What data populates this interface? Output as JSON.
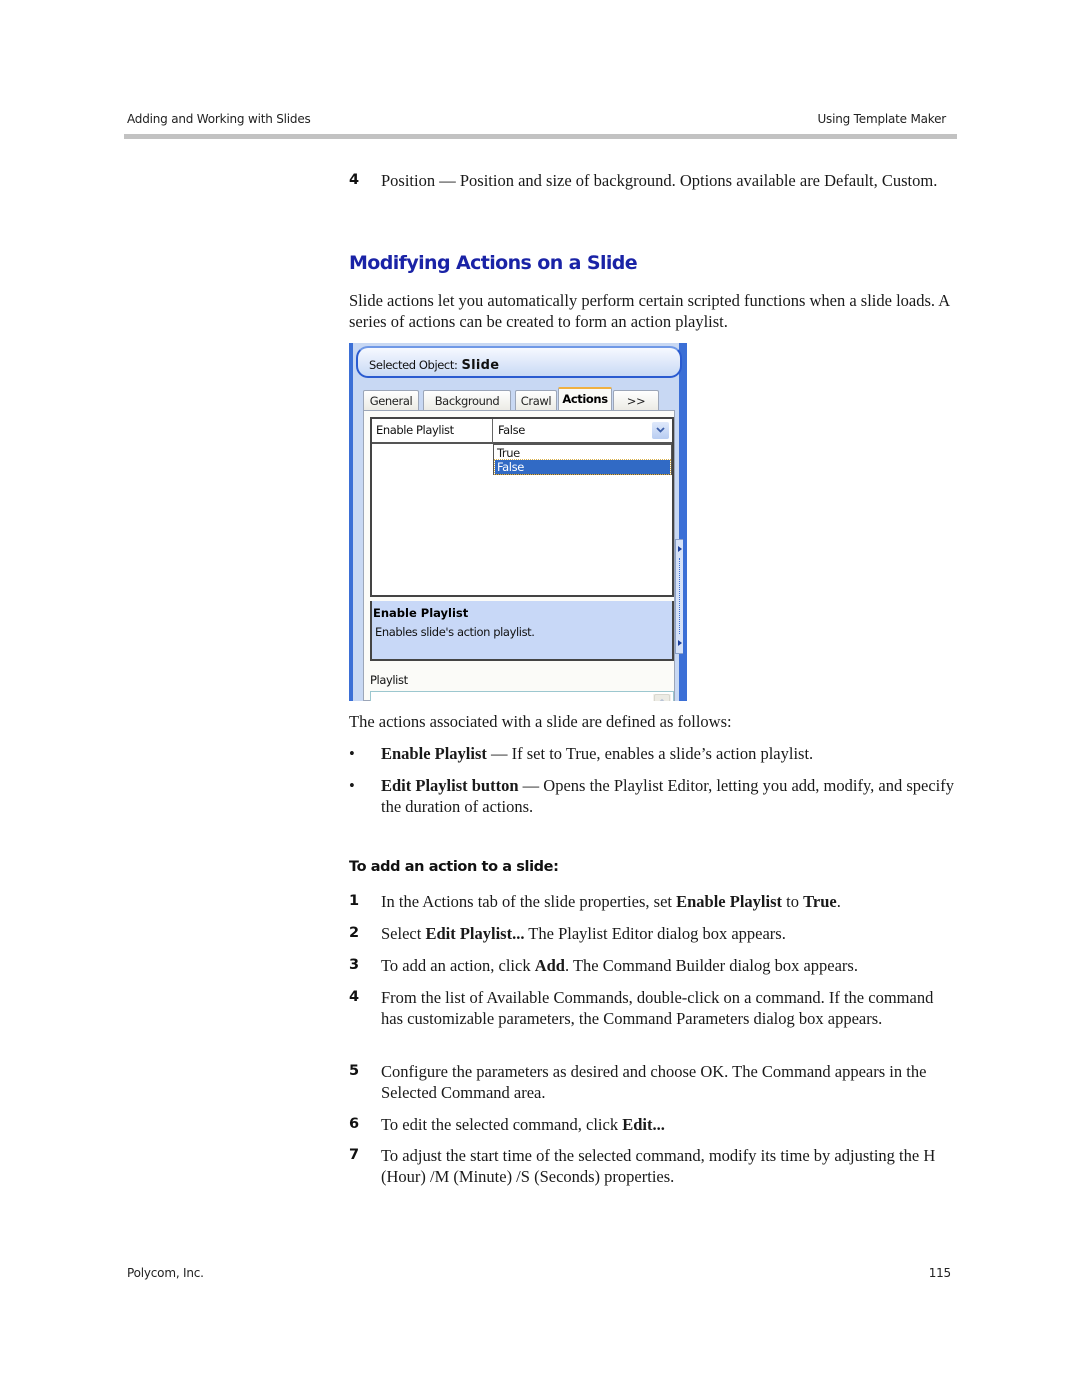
{
  "header": {
    "left": "Adding and Working with Slides",
    "right": "Using Template Maker"
  },
  "intro_step": {
    "number": "4",
    "text": "Position — Position and size of background. Options available are Default, Custom."
  },
  "section": {
    "title": "Modifying Actions on a Slide",
    "intro": "Slide actions let you automatically perform certain scripted functions when a slide loads. A series of actions can be created to form an action playlist."
  },
  "screenshot": {
    "selected_object_label": "Selected Object:",
    "selected_object_value": "Slide",
    "tabs": [
      {
        "label": "General",
        "active": false
      },
      {
        "label": "Background",
        "active": false
      },
      {
        "label": "Crawl",
        "active": false
      },
      {
        "label": "Actions",
        "active": true
      },
      {
        "label": ">>",
        "active": false
      }
    ],
    "property": {
      "name": "Enable Playlist",
      "value": "False",
      "options": [
        {
          "label": "True",
          "selected": false
        },
        {
          "label": "False",
          "selected": true
        }
      ]
    },
    "description": {
      "title": "Enable Playlist",
      "text": "Enables slide's action playlist."
    },
    "playlist_label": "Playlist",
    "colors": {
      "frame": "#3b6fd6",
      "selection": "#316ac5",
      "description_bg": "#c8d8f7"
    }
  },
  "definitions": {
    "intro": "The actions associated with a slide are defined as follows:",
    "items": [
      {
        "term": "Enable Playlist",
        "text": " — If set to True, enables a slide’s action playlist."
      },
      {
        "term": "Edit Playlist button",
        "text": " — Opens the Playlist Editor, letting you add, modify, and specify the duration of actions."
      }
    ]
  },
  "procedure": {
    "title": "To add an action to a slide:",
    "steps": [
      {
        "number": "1",
        "parts": [
          "In the Actions tab of the slide properties, set ",
          "Enable Playlist",
          " to ",
          "True",
          "."
        ]
      },
      {
        "number": "2",
        "parts": [
          "Select ",
          "Edit Playlist...",
          " The Playlist Editor dialog box appears."
        ]
      },
      {
        "number": "3",
        "parts": [
          "To add an action, click ",
          "Add",
          ". The Command Builder dialog box appears."
        ]
      },
      {
        "number": "4",
        "parts": [
          "From the list of Available Commands, double-click on a command. If the command has customizable parameters, the Command Parameters dialog box appears."
        ]
      },
      {
        "number": "5",
        "parts": [
          "Configure the parameters as desired and choose OK. The Command appears in the Selected Command area."
        ]
      },
      {
        "number": "6",
        "parts": [
          "To edit the selected command, click ",
          "Edit..."
        ]
      },
      {
        "number": "7",
        "parts": [
          "To adjust the start time of the selected command, modify its time by adjusting the H (Hour) /M (Minute) /S (Seconds) properties."
        ]
      }
    ]
  },
  "footer": {
    "left": "Polycom, Inc.",
    "page_number": "115"
  }
}
